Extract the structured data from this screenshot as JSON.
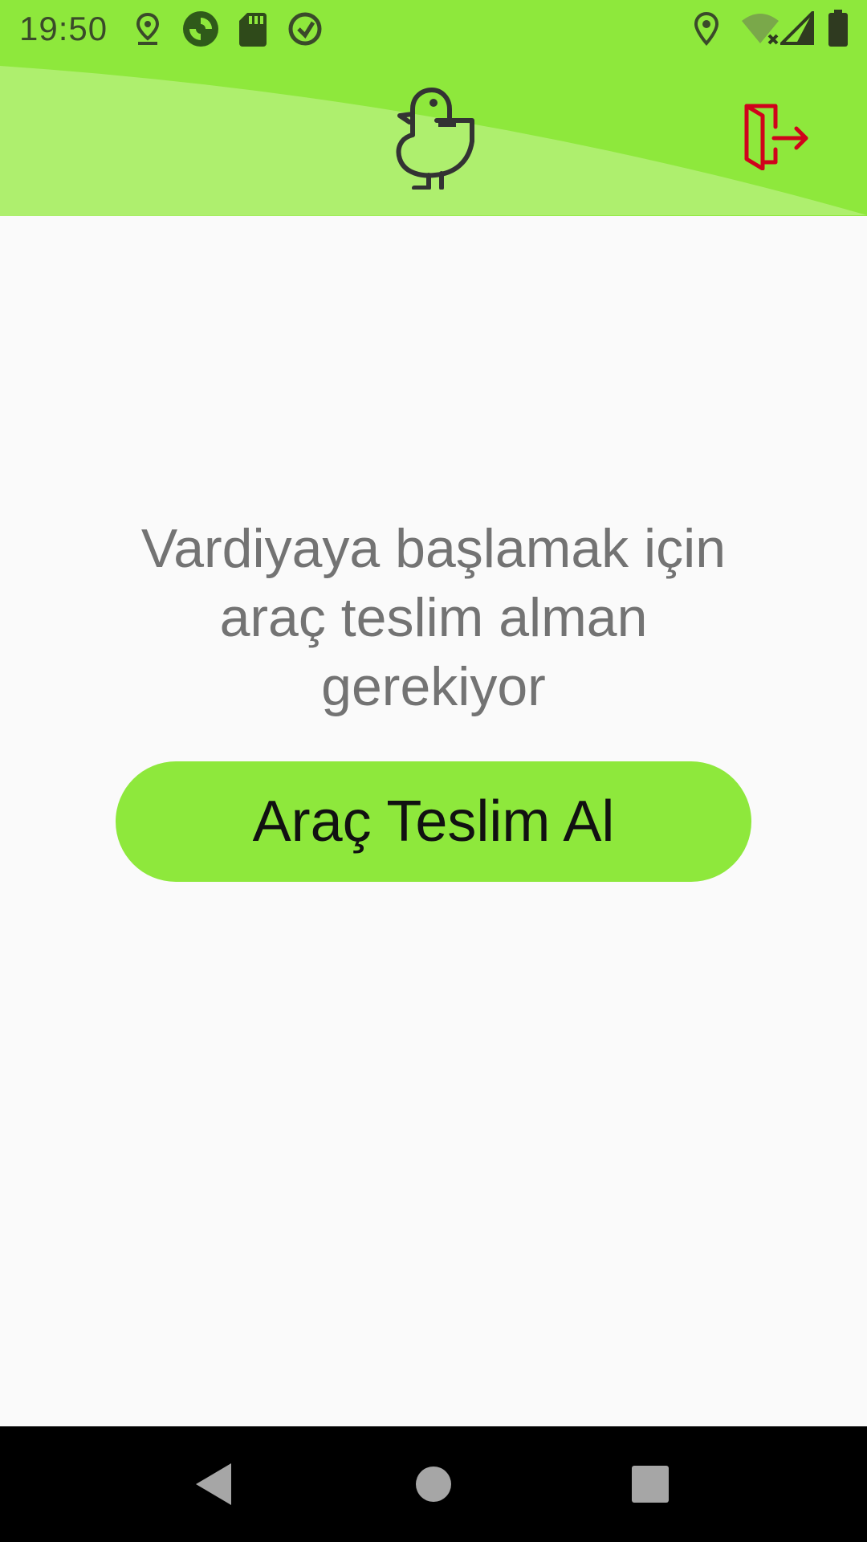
{
  "status_bar": {
    "time": "19:50",
    "left_icons": [
      "location-pin-icon",
      "sync-app-icon",
      "sd-card-icon",
      "qr-app-icon"
    ],
    "right_icons": [
      "location-icon",
      "wifi-off-icon",
      "signal-icon",
      "battery-icon"
    ]
  },
  "header": {
    "logo_icon": "duck-logo-icon",
    "logout_icon": "logout-door-icon",
    "colors": {
      "background": "#8ee83c",
      "wave": "#aeef6e",
      "logout": "#d0021b"
    }
  },
  "main": {
    "message": "Vardiyaya başlamak için araç teslim alman gerekiyor",
    "button_label": "Araç Teslim Al",
    "colors": {
      "button": "#8ee83c",
      "message_text": "#737373"
    }
  },
  "nav_bar": {
    "back_icon": "back-triangle-icon",
    "home_icon": "home-circle-icon",
    "recents_icon": "recents-square-icon"
  }
}
